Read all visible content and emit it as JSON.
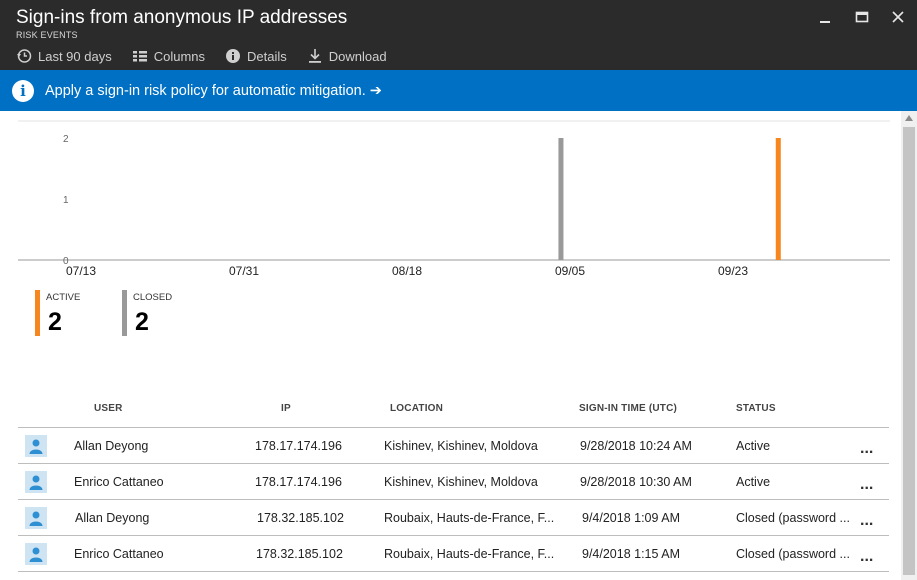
{
  "window": {
    "title": "Sign-ins from anonymous IP addresses",
    "subtitle": "RISK EVENTS"
  },
  "toolbar": {
    "items": [
      {
        "label": "Last 90 days",
        "icon": "history-icon"
      },
      {
        "label": "Columns",
        "icon": "columns-icon"
      },
      {
        "label": "Details",
        "icon": "info-icon"
      },
      {
        "label": "Download",
        "icon": "download-icon"
      }
    ]
  },
  "banner": {
    "text": "Apply a sign-in risk policy for automatic mitigation. ➔",
    "color": "#0070c4"
  },
  "chart_data": {
    "type": "bar",
    "yticks": [
      "0",
      "1",
      "2"
    ],
    "ylim": [
      0,
      2
    ],
    "xticks": [
      "07/13",
      "07/31",
      "08/18",
      "09/05",
      "09/23"
    ],
    "series": [
      {
        "status": "CLOSED",
        "color": "#999999",
        "x": "09/04",
        "value": 2
      },
      {
        "status": "ACTIVE",
        "color": "#f7861e",
        "x": "09/28",
        "value": 2
      }
    ]
  },
  "summary": [
    {
      "label": "ACTIVE",
      "count": "2",
      "color": "#f7861e"
    },
    {
      "label": "CLOSED",
      "count": "2",
      "color": "#999999"
    }
  ],
  "table": {
    "headers": {
      "user": "USER",
      "ip": "IP",
      "location": "LOCATION",
      "time": "SIGN-IN TIME (UTC)",
      "status": "STATUS"
    },
    "rows": [
      {
        "user": "Allan Deyong",
        "ip": "178.17.174.196",
        "location": "Kishinev, Kishinev, Moldova",
        "time": "9/28/2018 10:24 AM",
        "status": "Active",
        "more": "..."
      },
      {
        "user": "Enrico Cattaneo",
        "ip": "178.17.174.196",
        "location": "Kishinev, Kishinev, Moldova",
        "time": "9/28/2018 10:30 AM",
        "status": "Active",
        "more": "..."
      },
      {
        "user": "Allan Deyong",
        "ip": "178.32.185.102",
        "location": "Roubaix, Hauts-de-France, F...",
        "time": "9/4/2018 1:09 AM",
        "status": "Closed (password ...",
        "more": "..."
      },
      {
        "user": "Enrico Cattaneo",
        "ip": "178.32.185.102",
        "location": "Roubaix, Hauts-de-France, F...",
        "time": "9/4/2018 1:15 AM",
        "status": "Closed (password ...",
        "more": "..."
      }
    ]
  }
}
